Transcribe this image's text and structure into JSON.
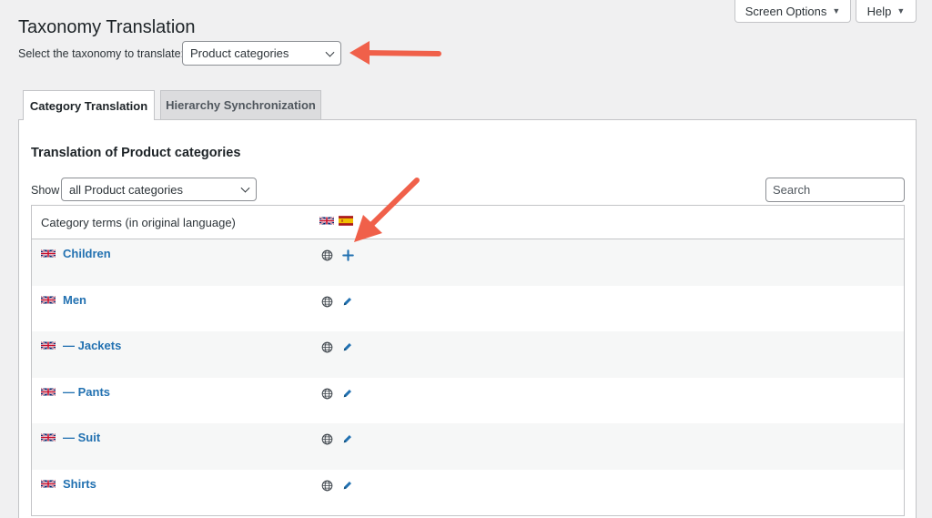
{
  "header": {
    "screen_options": "Screen Options",
    "help": "Help",
    "title": "Taxonomy Translation",
    "taxonomy_label": "Select the taxonomy to translate:",
    "taxonomy_selected": "Product categories"
  },
  "tabs": [
    {
      "label": "Category Translation",
      "active": true
    },
    {
      "label": "Hierarchy Synchronization",
      "active": false
    }
  ],
  "panel": {
    "title": "Translation of Product categories",
    "show_label": "Show",
    "show_selected": "all Product categories",
    "search_placeholder": "Search"
  },
  "table": {
    "header_label": "Category terms (in original language)",
    "language_flags": [
      "uk-flag-icon",
      "es-flag-icon"
    ],
    "rows": [
      {
        "term": "Children",
        "action": "plus-icon"
      },
      {
        "term": "Men",
        "action": "pencil-icon"
      },
      {
        "term": "— Jackets",
        "action": "pencil-icon"
      },
      {
        "term": "— Pants",
        "action": "pencil-icon"
      },
      {
        "term": "— Suit",
        "action": "pencil-icon"
      },
      {
        "term": "Shirts",
        "action": "pencil-icon"
      }
    ]
  },
  "colors": {
    "link": "#2271b1",
    "arrow": "#f0604a",
    "background": "#f0f0f1"
  }
}
